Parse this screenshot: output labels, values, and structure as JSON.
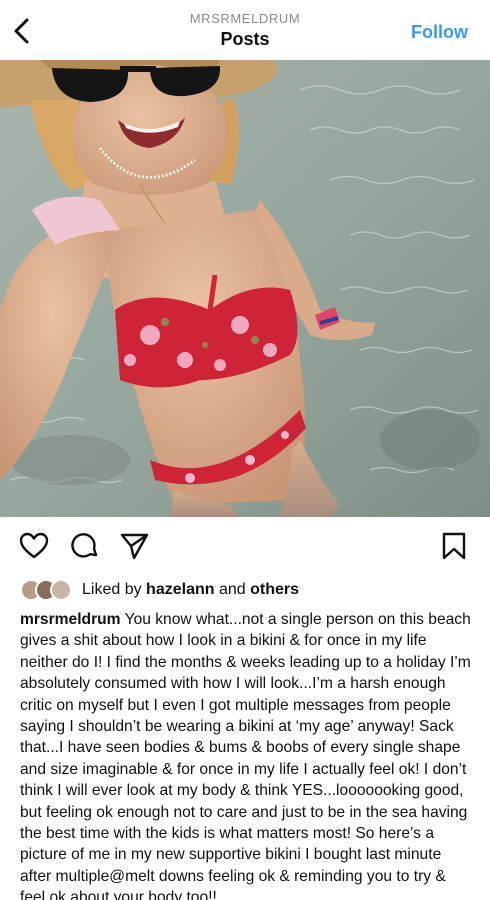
{
  "header": {
    "account": "MRSRMELDRUM",
    "title": "Posts",
    "follow_label": "Follow"
  },
  "photo": {
    "alt": "Selfie in shallow sea water wearing a red floral bikini and sun hat"
  },
  "actions": {
    "like_icon": "heart-icon",
    "comment_icon": "comment-icon",
    "share_icon": "share-icon",
    "save_icon": "bookmark-icon"
  },
  "likes": {
    "prefix": "Liked by",
    "user": "hazelann",
    "connector": "and",
    "others": "others"
  },
  "caption": {
    "username": "mrsrmeldrum",
    "text": "You know what...not a single person on this beach gives a shit about how I look in a bikini & for once in my life neither do I! I find the months & weeks leading up to a holiday I’m absolutely consumed with how I will look...I’m a harsh enough critic on myself but I even I got multiple messages from people saying I shouldn’t be wearing a bikini at ‘my age’ anyway! Sack that...I have seen bodies & bums & boobs of every single shape and  size imaginable & for once in my life I actually feel ok! I don’t think I will ever look at my body & think YES...looooooking good, but feeling ok enough not to care and just to be in the sea having the best time with the kids is what matters most! So here’s a picture of me in my new supportive bikini I bought last minute after multiple@melt downs feeling ok & reminding you to try & feel ok about your body too!!"
  },
  "colors": {
    "follow": "#3d97f0",
    "muted": "#8a8a8a",
    "text": "#111111"
  }
}
